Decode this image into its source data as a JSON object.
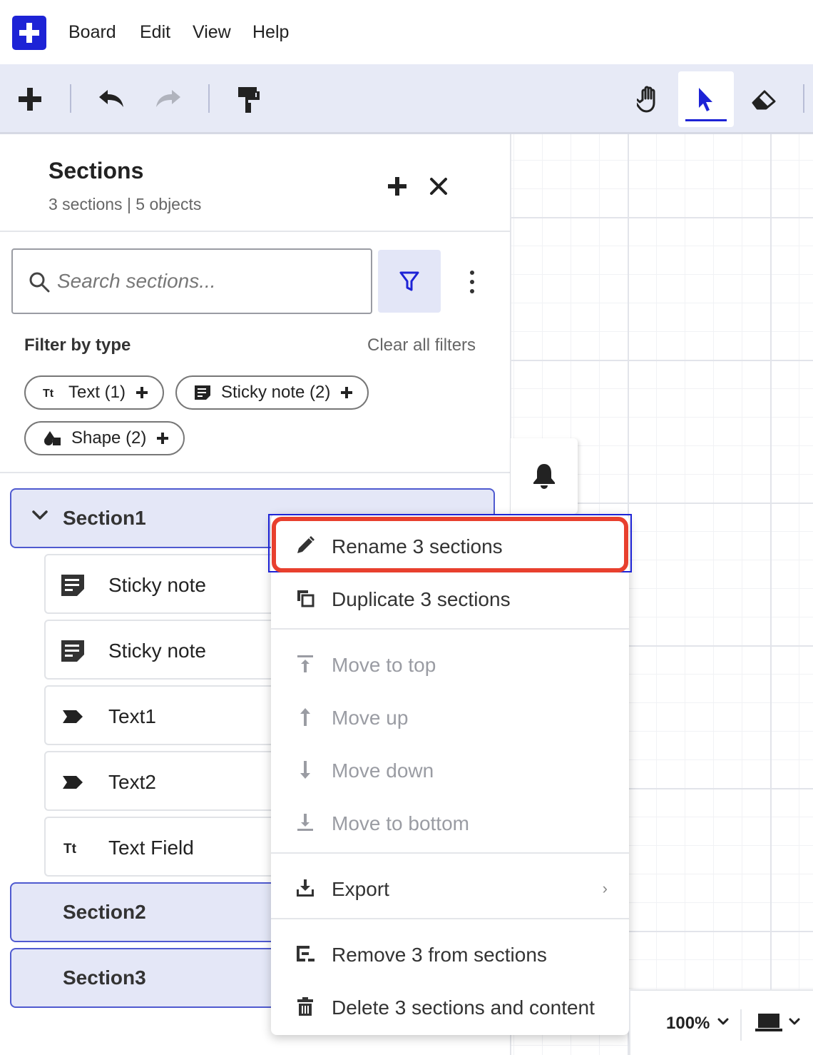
{
  "menubar": {
    "items": [
      "Board",
      "Edit",
      "View",
      "Help"
    ]
  },
  "toolbar": {
    "tools": [
      "add-icon",
      "undo-icon",
      "redo-icon",
      "format-painter-icon",
      "hand-icon",
      "pointer-icon",
      "eraser-icon"
    ],
    "active_tool": "pointer-icon"
  },
  "panel": {
    "title": "Sections",
    "subtitle": "3 sections | 5 objects",
    "search_placeholder": "Search sections...",
    "filter_label": "Filter by type",
    "clear_filters": "Clear all filters",
    "chips": [
      {
        "label": "Text (1)",
        "icon": "text-type-icon"
      },
      {
        "label": "Sticky note (2)",
        "icon": "sticky-note-icon"
      },
      {
        "label": "Shape (2)",
        "icon": "shape-icon"
      }
    ],
    "sections": [
      {
        "label": "Section1",
        "expanded": true
      },
      {
        "label": "Section2"
      },
      {
        "label": "Section3"
      }
    ],
    "items": [
      {
        "label": "Sticky note",
        "icon": "sticky-note-icon"
      },
      {
        "label": "Sticky note",
        "icon": "sticky-note-icon"
      },
      {
        "label": "Text1",
        "icon": "tag-icon"
      },
      {
        "label": "Text2",
        "icon": "tag-icon"
      },
      {
        "label": "Text Field",
        "icon": "text-type-icon"
      }
    ]
  },
  "context_menu": {
    "items": [
      {
        "label": "Rename 3 sections",
        "icon": "pencil-icon",
        "disabled": false
      },
      {
        "label": "Duplicate 3 sections",
        "icon": "duplicate-icon",
        "disabled": false
      },
      {
        "label": "Move to top",
        "icon": "move-top-icon",
        "disabled": true
      },
      {
        "label": "Move up",
        "icon": "arrow-up-icon",
        "disabled": true
      },
      {
        "label": "Move down",
        "icon": "arrow-down-icon",
        "disabled": true
      },
      {
        "label": "Move to bottom",
        "icon": "move-bottom-icon",
        "disabled": true
      },
      {
        "label": "Export",
        "icon": "download-icon",
        "disabled": false
      },
      {
        "label": "Remove 3 from sections",
        "icon": "remove-from-section-icon",
        "disabled": false
      },
      {
        "label": "Delete 3 sections and content",
        "icon": "trash-icon",
        "disabled": false
      }
    ],
    "export_arrow": "›"
  },
  "bottom_bar": {
    "zoom": "100%"
  },
  "colors": {
    "accent": "#1d23d6",
    "toolbar_bg": "#e7eaf6",
    "section_bg": "#e4e7f7",
    "highlight": "#e8402e"
  }
}
